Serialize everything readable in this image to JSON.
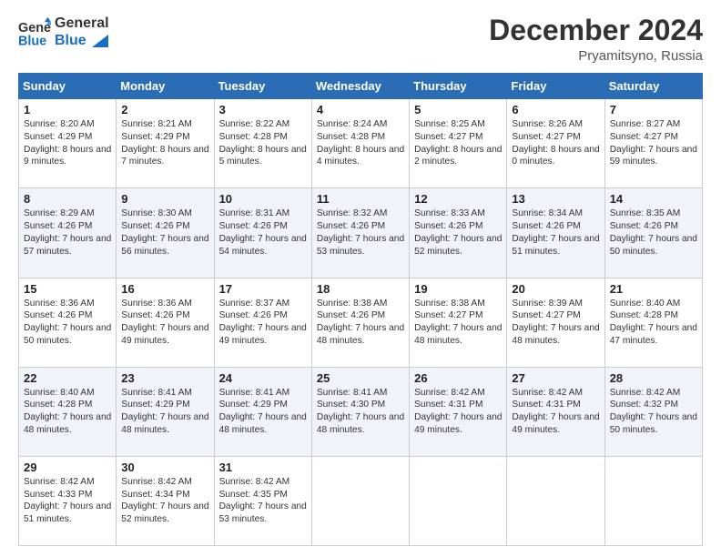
{
  "header": {
    "logo_line1": "General",
    "logo_line2": "Blue",
    "month": "December 2024",
    "location": "Pryamitsyno, Russia"
  },
  "weekdays": [
    "Sunday",
    "Monday",
    "Tuesday",
    "Wednesday",
    "Thursday",
    "Friday",
    "Saturday"
  ],
  "weeks": [
    [
      {
        "day": "1",
        "sunrise": "8:20 AM",
        "sunset": "4:29 PM",
        "daylight": "8 hours and 9 minutes."
      },
      {
        "day": "2",
        "sunrise": "8:21 AM",
        "sunset": "4:29 PM",
        "daylight": "8 hours and 7 minutes."
      },
      {
        "day": "3",
        "sunrise": "8:22 AM",
        "sunset": "4:28 PM",
        "daylight": "8 hours and 5 minutes."
      },
      {
        "day": "4",
        "sunrise": "8:24 AM",
        "sunset": "4:28 PM",
        "daylight": "8 hours and 4 minutes."
      },
      {
        "day": "5",
        "sunrise": "8:25 AM",
        "sunset": "4:27 PM",
        "daylight": "8 hours and 2 minutes."
      },
      {
        "day": "6",
        "sunrise": "8:26 AM",
        "sunset": "4:27 PM",
        "daylight": "8 hours and 0 minutes."
      },
      {
        "day": "7",
        "sunrise": "8:27 AM",
        "sunset": "4:27 PM",
        "daylight": "7 hours and 59 minutes."
      }
    ],
    [
      {
        "day": "8",
        "sunrise": "8:29 AM",
        "sunset": "4:26 PM",
        "daylight": "7 hours and 57 minutes."
      },
      {
        "day": "9",
        "sunrise": "8:30 AM",
        "sunset": "4:26 PM",
        "daylight": "7 hours and 56 minutes."
      },
      {
        "day": "10",
        "sunrise": "8:31 AM",
        "sunset": "4:26 PM",
        "daylight": "7 hours and 54 minutes."
      },
      {
        "day": "11",
        "sunrise": "8:32 AM",
        "sunset": "4:26 PM",
        "daylight": "7 hours and 53 minutes."
      },
      {
        "day": "12",
        "sunrise": "8:33 AM",
        "sunset": "4:26 PM",
        "daylight": "7 hours and 52 minutes."
      },
      {
        "day": "13",
        "sunrise": "8:34 AM",
        "sunset": "4:26 PM",
        "daylight": "7 hours and 51 minutes."
      },
      {
        "day": "14",
        "sunrise": "8:35 AM",
        "sunset": "4:26 PM",
        "daylight": "7 hours and 50 minutes."
      }
    ],
    [
      {
        "day": "15",
        "sunrise": "8:36 AM",
        "sunset": "4:26 PM",
        "daylight": "7 hours and 50 minutes."
      },
      {
        "day": "16",
        "sunrise": "8:36 AM",
        "sunset": "4:26 PM",
        "daylight": "7 hours and 49 minutes."
      },
      {
        "day": "17",
        "sunrise": "8:37 AM",
        "sunset": "4:26 PM",
        "daylight": "7 hours and 49 minutes."
      },
      {
        "day": "18",
        "sunrise": "8:38 AM",
        "sunset": "4:26 PM",
        "daylight": "7 hours and 48 minutes."
      },
      {
        "day": "19",
        "sunrise": "8:38 AM",
        "sunset": "4:27 PM",
        "daylight": "7 hours and 48 minutes."
      },
      {
        "day": "20",
        "sunrise": "8:39 AM",
        "sunset": "4:27 PM",
        "daylight": "7 hours and 48 minutes."
      },
      {
        "day": "21",
        "sunrise": "8:40 AM",
        "sunset": "4:28 PM",
        "daylight": "7 hours and 47 minutes."
      }
    ],
    [
      {
        "day": "22",
        "sunrise": "8:40 AM",
        "sunset": "4:28 PM",
        "daylight": "7 hours and 48 minutes."
      },
      {
        "day": "23",
        "sunrise": "8:41 AM",
        "sunset": "4:29 PM",
        "daylight": "7 hours and 48 minutes."
      },
      {
        "day": "24",
        "sunrise": "8:41 AM",
        "sunset": "4:29 PM",
        "daylight": "7 hours and 48 minutes."
      },
      {
        "day": "25",
        "sunrise": "8:41 AM",
        "sunset": "4:30 PM",
        "daylight": "7 hours and 48 minutes."
      },
      {
        "day": "26",
        "sunrise": "8:42 AM",
        "sunset": "4:31 PM",
        "daylight": "7 hours and 49 minutes."
      },
      {
        "day": "27",
        "sunrise": "8:42 AM",
        "sunset": "4:31 PM",
        "daylight": "7 hours and 49 minutes."
      },
      {
        "day": "28",
        "sunrise": "8:42 AM",
        "sunset": "4:32 PM",
        "daylight": "7 hours and 50 minutes."
      }
    ],
    [
      {
        "day": "29",
        "sunrise": "8:42 AM",
        "sunset": "4:33 PM",
        "daylight": "7 hours and 51 minutes."
      },
      {
        "day": "30",
        "sunrise": "8:42 AM",
        "sunset": "4:34 PM",
        "daylight": "7 hours and 52 minutes."
      },
      {
        "day": "31",
        "sunrise": "8:42 AM",
        "sunset": "4:35 PM",
        "daylight": "7 hours and 53 minutes."
      },
      null,
      null,
      null,
      null
    ]
  ]
}
